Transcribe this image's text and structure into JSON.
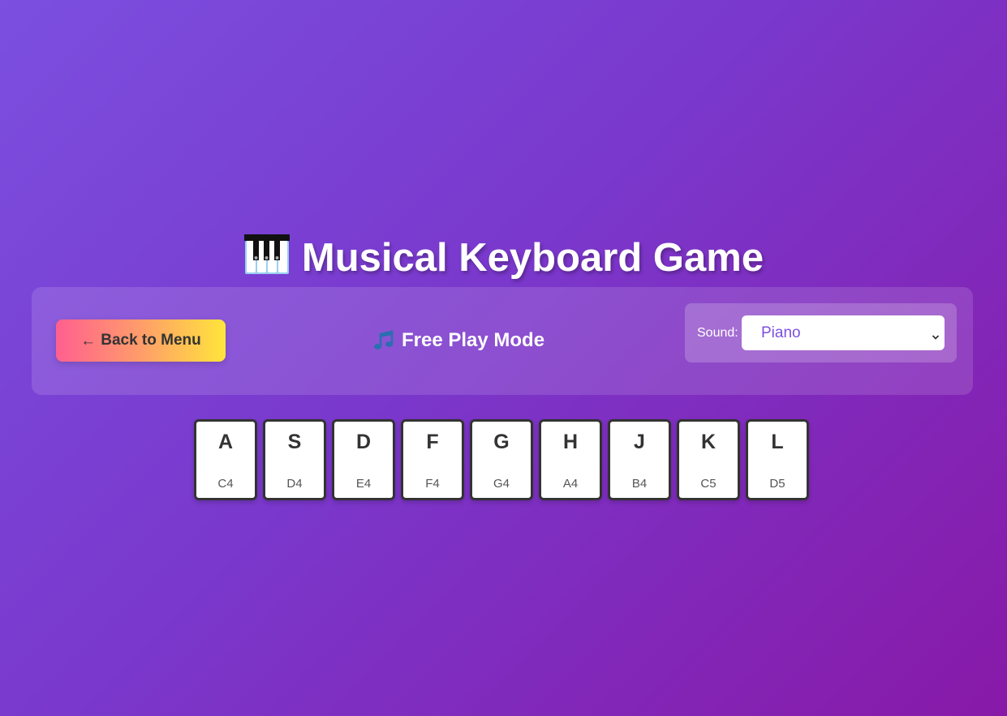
{
  "header": {
    "title": "Musical Keyboard Game",
    "title_icon": "piano-icon"
  },
  "controls": {
    "back_label": "Back to Menu",
    "back_icon": "left-arrow-icon",
    "mode_label": "Free Play Mode",
    "mode_icon": "musical-note-icon",
    "sound_label": "Sound:",
    "sound_selected": "Piano"
  },
  "keyboard": {
    "keys": [
      {
        "letter": "A",
        "note": "C4"
      },
      {
        "letter": "S",
        "note": "D4"
      },
      {
        "letter": "D",
        "note": "E4"
      },
      {
        "letter": "F",
        "note": "F4"
      },
      {
        "letter": "G",
        "note": "G4"
      },
      {
        "letter": "H",
        "note": "A4"
      },
      {
        "letter": "J",
        "note": "B4"
      },
      {
        "letter": "K",
        "note": "C5"
      },
      {
        "letter": "L",
        "note": "D5"
      }
    ]
  },
  "colors": {
    "background_start": "#7b4fe0",
    "background_end": "#8819a8",
    "button_gradient_start": "#ff5f8f",
    "button_gradient_end": "#ffe53b",
    "select_text": "#7b4fe0",
    "key_border": "#333333"
  }
}
